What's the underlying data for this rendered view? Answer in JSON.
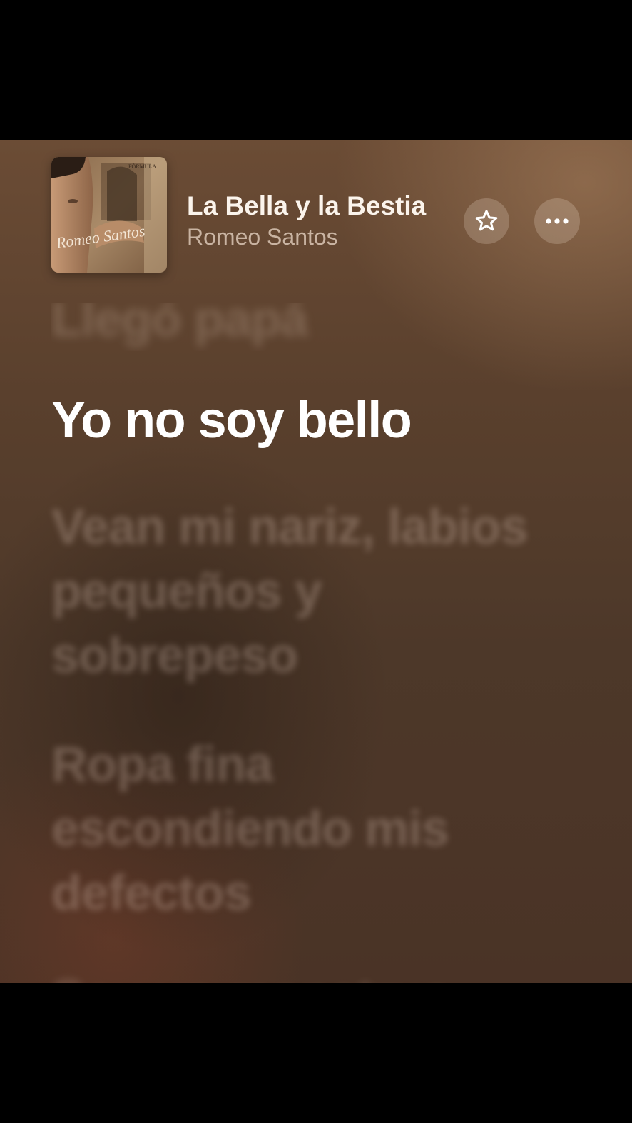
{
  "now_playing": {
    "title": "La Bella y la Bestia",
    "artist": "Romeo Santos",
    "album_art": {
      "artist_script": "Romeo Santos",
      "album_caption": "FÓRMULA"
    }
  },
  "controls": {
    "favorite_icon": "star-icon",
    "more_icon": "ellipsis-icon"
  },
  "lyrics": {
    "previous_line": "Llegó papá",
    "current_line": "Yo no soy bello",
    "upcoming_lines": [
      "Vean mi nariz, labios pequeños y sobrepeso",
      "Ropa fina escondiendo mis defectos",
      "Soy un monstruo"
    ]
  },
  "colors": {
    "background_top": "#6b4c35",
    "background_bottom": "#4a3326",
    "active_lyric": "#ffffff",
    "title_text": "#fbf4ec"
  }
}
